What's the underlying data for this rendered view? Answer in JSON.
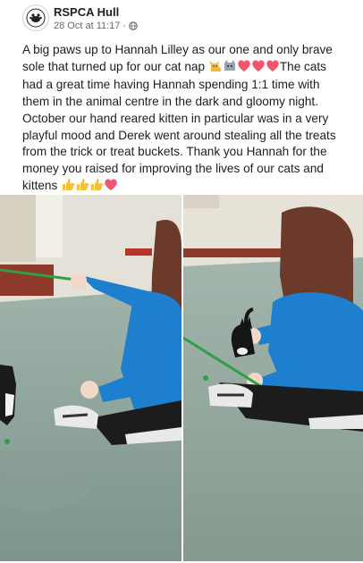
{
  "post": {
    "page_name": "RSPCA Hull",
    "timestamp": "28 Oct at 11:17",
    "separator": "·",
    "text_part1": "A big paws up to Hannah Lilley as our one and only brave sole that turned up for our cat nap ",
    "text_part2": "The cats had a great time having Hannah spending 1:1 time with them in the animal centre in the dark and gloomy night. October our hand reared kitten in particular was in a very playful mood and Derek went around stealing all the treats from the trick or treat buckets. Thank you Hannah for the money you raised for improving the lives of our cats and kittens "
  },
  "icons": {
    "avatar": "rspca-logo",
    "privacy": "globe-icon",
    "emojis": [
      "cat-emoji",
      "cat-face-emoji",
      "heart-emoji",
      "heart-emoji",
      "heart-emoji",
      "thumbs-up-emoji",
      "thumbs-up-emoji",
      "thumbs-up-emoji",
      "heart-emoji"
    ]
  },
  "colors": {
    "heart": "#f2556f",
    "thumb": "#f7c23a",
    "hoodie": "#1e7fcf",
    "floor": "#8fa59b"
  }
}
